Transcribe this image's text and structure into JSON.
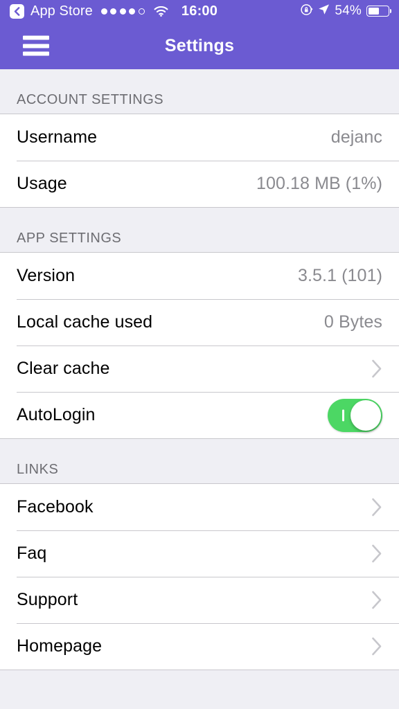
{
  "statusbar": {
    "back_icon": "back-chevron-icon",
    "carrier": "App Store",
    "signal_dots_total": 5,
    "signal_dots_filled": 4,
    "wifi_icon": "wifi-icon",
    "time": "16:00",
    "rotation_lock_icon": "rotation-lock-icon",
    "location_icon": "location-arrow-icon",
    "battery_percent": "54%",
    "battery_level": 54
  },
  "navbar": {
    "menu_icon": "hamburger-menu-icon",
    "title": "Settings",
    "background_color": "#6B5BD2"
  },
  "sections": [
    {
      "header": "ACCOUNT SETTINGS",
      "rows": [
        {
          "label": "Username",
          "value": "dejanc",
          "accessory": "none"
        },
        {
          "label": "Usage",
          "value": "100.18 MB (1%)",
          "accessory": "none"
        }
      ]
    },
    {
      "header": "APP SETTINGS",
      "rows": [
        {
          "label": "Version",
          "value": "3.5.1 (101)",
          "accessory": "none"
        },
        {
          "label": "Local cache used",
          "value": "0 Bytes",
          "accessory": "none"
        },
        {
          "label": "Clear cache",
          "value": "",
          "accessory": "chevron"
        },
        {
          "label": "AutoLogin",
          "value": "",
          "accessory": "toggle",
          "toggle_on": true
        }
      ]
    },
    {
      "header": "LINKS",
      "rows": [
        {
          "label": "Facebook",
          "value": "",
          "accessory": "chevron"
        },
        {
          "label": "Faq",
          "value": "",
          "accessory": "chevron"
        },
        {
          "label": "Support",
          "value": "",
          "accessory": "chevron"
        },
        {
          "label": "Homepage",
          "value": "",
          "accessory": "chevron"
        }
      ]
    }
  ],
  "colors": {
    "accent_purple": "#6B5BD2",
    "toggle_green": "#4CD764",
    "value_gray": "#8A8A8F",
    "header_gray": "#6D6D72",
    "group_bg": "#EFEFF4"
  }
}
